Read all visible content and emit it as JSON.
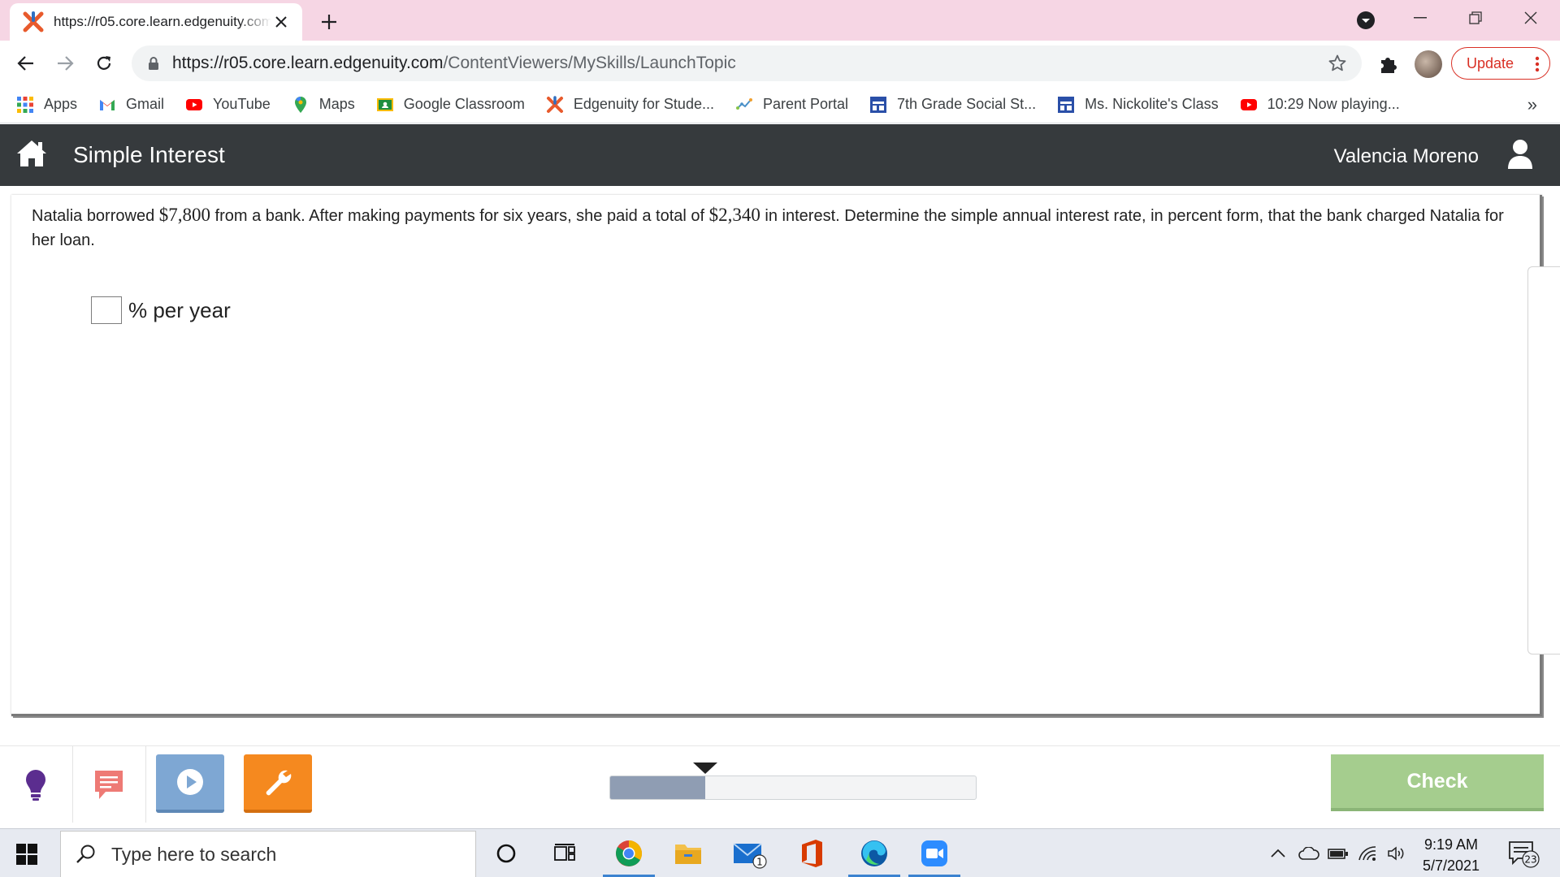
{
  "browser": {
    "tab_title": "https://r05.core.learn.edgenuity.com/ContentViewers/MySkills/LaunchTopic",
    "url_host": "https://r05.core.learn.edgenuity.com",
    "url_path": "/ContentViewers/MySkills/LaunchTopic",
    "update_label": "Update",
    "bookmarks": [
      {
        "label": "Apps",
        "icon": "apps-grid-icon"
      },
      {
        "label": "Gmail",
        "icon": "gmail-icon"
      },
      {
        "label": "YouTube",
        "icon": "youtube-icon"
      },
      {
        "label": "Maps",
        "icon": "maps-pin-icon"
      },
      {
        "label": "Google Classroom",
        "icon": "classroom-icon"
      },
      {
        "label": "Edgenuity for Stude...",
        "icon": "edgenuity-icon"
      },
      {
        "label": "Parent Portal",
        "icon": "portal-icon"
      },
      {
        "label": "7th Grade Social St...",
        "icon": "calendar-icon"
      },
      {
        "label": "Ms. Nickolite's Class",
        "icon": "calendar-icon"
      },
      {
        "label": "10:29 Now playing...",
        "icon": "youtube-icon"
      }
    ],
    "bookmarks_more": "»"
  },
  "app": {
    "title": "Simple Interest",
    "user_name": "Valencia Moreno"
  },
  "question": {
    "part1": "Natalia borrowed ",
    "amount1": "$7,800",
    "part2": " from a bank. After making payments for six years, she paid a total of ",
    "amount2": "$2,340",
    "part3": " in interest. Determine the simple annual interest rate, in percent form, that the bank charged Natalia for her loan.",
    "answer_value": "",
    "answer_unit": "% per year"
  },
  "bottom": {
    "progress_fraction": 0.26,
    "check_label": "Check"
  },
  "taskbar": {
    "search_placeholder": "Type here to search",
    "time": "9:19 AM",
    "date": "5/7/2021",
    "mail_badge": "1",
    "notification_count": "23"
  },
  "colors": {
    "header_bg": "#363a3d",
    "check_bg": "#a5cd8e",
    "wrench_bg": "#f5891f",
    "play_bg": "#7ea7d3",
    "progress_fill": "#8f9db3"
  }
}
